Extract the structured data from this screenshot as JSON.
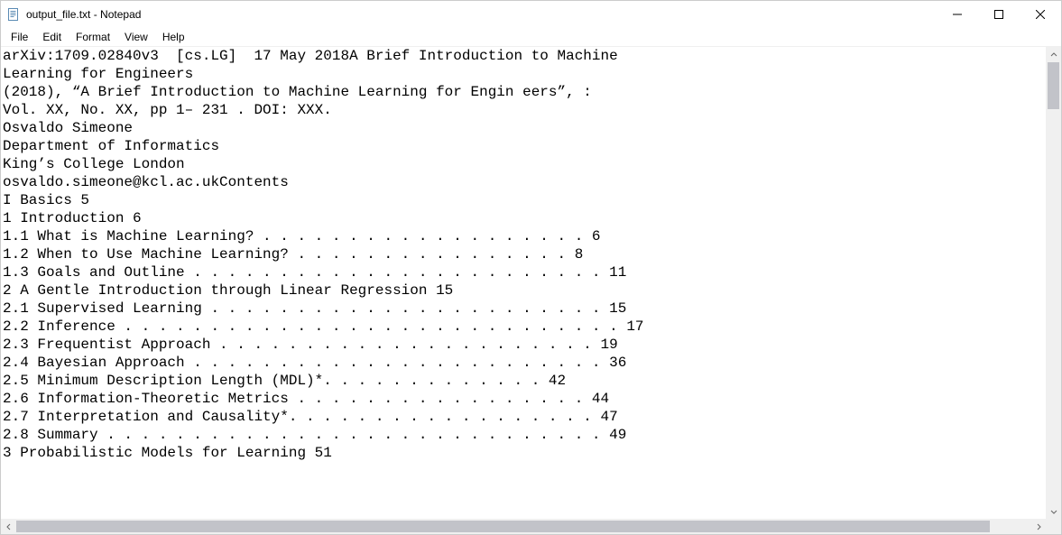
{
  "window": {
    "title": "output_file.txt - Notepad"
  },
  "menu": {
    "file": "File",
    "edit": "Edit",
    "format": "Format",
    "view": "View",
    "help": "Help"
  },
  "content": "arXiv:1709.02840v3  [cs.LG]  17 May 2018A Brief Introduction to Machine\nLearning for Engineers\n(2018), “A Brief Introduction to Machine Learning for Engin eers”, :\nVol. XX, No. XX, pp 1– 231 . DOI: XXX.\nOsvaldo Simeone\nDepartment of Informatics\nKing’s College London\nosvaldo.simeone@kcl.ac.ukContents\nI Basics 5\n1 Introduction 6\n1.1 What is Machine Learning? . . . . . . . . . . . . . . . . . . . 6\n1.2 When to Use Machine Learning? . . . . . . . . . . . . . . . . 8\n1.3 Goals and Outline . . . . . . . . . . . . . . . . . . . . . . . . 11\n2 A Gentle Introduction through Linear Regression 15\n2.1 Supervised Learning . . . . . . . . . . . . . . . . . . . . . . . 15\n2.2 Inference . . . . . . . . . . . . . . . . . . . . . . . . . . . . . 17\n2.3 Frequentist Approach . . . . . . . . . . . . . . . . . . . . . . 19\n2.4 Bayesian Approach . . . . . . . . . . . . . . . . . . . . . . . . 36\n2.5 Minimum Description Length (MDL)*. . . . . . . . . . . . . 42\n2.6 Information-Theoretic Metrics . . . . . . . . . . . . . . . . . 44\n2.7 Interpretation and Causality*. . . . . . . . . . . . . . . . . . 47\n2.8 Summary . . . . . . . . . . . . . . . . . . . . . . . . . . . . . 49\n3 Probabilistic Models for Learning 51"
}
